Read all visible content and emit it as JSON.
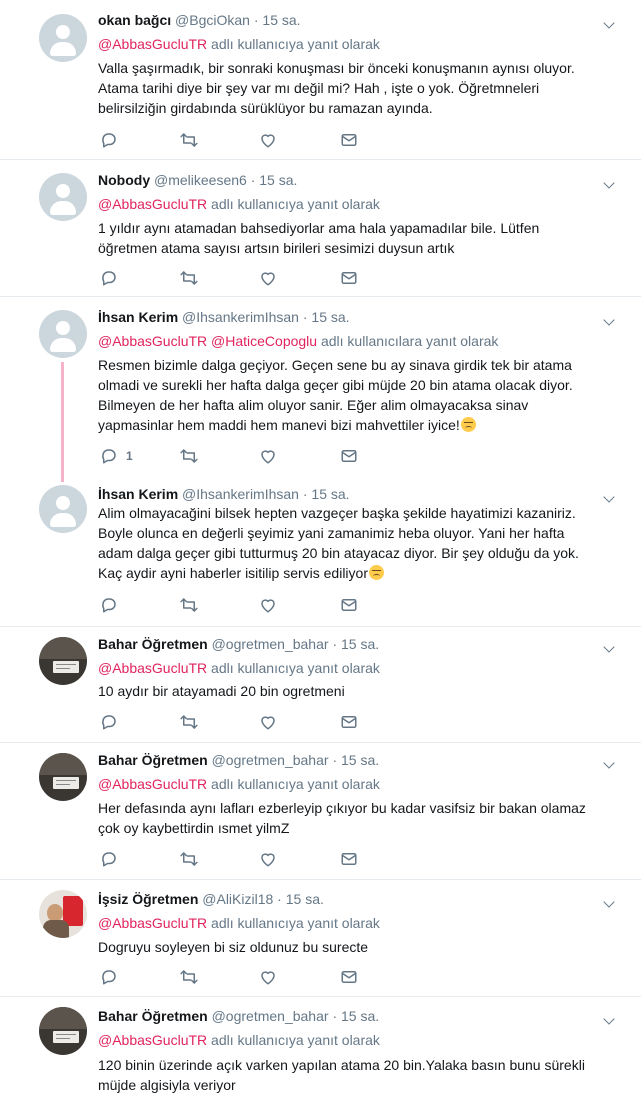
{
  "colors": {
    "mention": "#e0245e",
    "secondary_text": "#657786",
    "primary_text": "#14171a",
    "divider": "#e6ecf0",
    "thread_line": "#f4b3c6"
  },
  "icons": {
    "reply": "reply-icon",
    "retweet": "retweet-icon",
    "like": "heart-icon",
    "dm": "envelope-icon",
    "more": "chevron-down-icon"
  },
  "tweets": [
    {
      "avatar": "default-avatar",
      "name": "okan bağcı",
      "handle": "@BgciOkan",
      "dot": "·",
      "time": "15 sa.",
      "reply_mention": "@AbbasGucluTR",
      "reply_suffix": "adlı kullanıcıya yanıt olarak",
      "text": "Valla şaşırmadık, bir sonraki konuşması bir önceki konuşmanın aynısı oluyor.\nAtama tarihi diye bir şey var mı değil mi? Hah , işte o yok. Öğretmneleri\nbelirsilziğin girdabında sürüklüyor bu ramazan ayında.",
      "reply_count": ""
    },
    {
      "avatar": "default-avatar",
      "name": "Nobody",
      "handle": "@melikeesen6",
      "dot": "·",
      "time": "15 sa.",
      "reply_mention": "@AbbasGucluTR",
      "reply_suffix": "adlı kullanıcıya yanıt olarak",
      "text": "1 yıldır aynı atamadan bahsediyorlar ama hala yapamadılar bile. Lütfen\nöğretmen atama sayısı artsın birileri sesimizi duysun artık",
      "reply_count": ""
    },
    {
      "avatar": "default-avatar",
      "name": "İhsan Kerim",
      "handle": "@IhsankerimIhsan",
      "dot": "·",
      "time": "15 sa.",
      "reply_mention": "@AbbasGucluTR @HaticeCopoglu",
      "reply_suffix": "adlı kullanıcılara yanıt olarak",
      "text": "Resmen bizimle dalga geçiyor. Geçen sene bu ay sinava girdik tek bir atama\nolmadi ve surekli her hafta dalga geçer gibi müjde 20 bin atama olacak diyor.\nBilmeyen de her hafta alim oluyor sanir. Eğer alim olmayacaksa sinav\nyapmasinlar hem maddi hem manevi bizi mahvettiler iyice!",
      "reply_count": "1"
    },
    {
      "avatar": "default-avatar",
      "name": "İhsan Kerim",
      "handle": "@IhsankerimIhsan",
      "dot": "·",
      "time": "15 sa.",
      "reply_mention": "",
      "reply_suffix": "",
      "text": "Alim olmayacağini bilsek hepten vazgeçer başka şekilde hayatimizi kazaniriz.\nBoyle olunca en değerli şeyimiz yani zamanimiz heba oluyor. Yani her hafta\nadam dalga geçer gibi tutturmuş 20 bin atayacaz diyor. Bir şey olduğu da yok.\nKaç aydir ayni haberler isitilip servis ediliyor",
      "reply_count": ""
    },
    {
      "avatar": "photo-dark",
      "name": "Bahar Öğretmen",
      "handle": "@ogretmen_bahar",
      "dot": "·",
      "time": "15 sa.",
      "reply_mention": "@AbbasGucluTR",
      "reply_suffix": "adlı kullanıcıya yanıt olarak",
      "text": "10 aydır bir atayamadi 20 bin ogretmeni",
      "reply_count": ""
    },
    {
      "avatar": "photo-dark",
      "name": "Bahar Öğretmen",
      "handle": "@ogretmen_bahar",
      "dot": "·",
      "time": "15 sa.",
      "reply_mention": "@AbbasGucluTR",
      "reply_suffix": "adlı kullanıcıya yanıt olarak",
      "text": "Her defasında aynı lafları ezberleyip çıkıyor bu kadar vasifsiz bir bakan olamaz\nçok oy kaybettirdin ısmet yilmZ",
      "reply_count": ""
    },
    {
      "avatar": "photo-flag",
      "name": "İşsiz Öğretmen",
      "handle": "@AliKizil18",
      "dot": "·",
      "time": "15 sa.",
      "reply_mention": "@AbbasGucluTR",
      "reply_suffix": "adlı kullanıcıya yanıt olarak",
      "text": "Dogruyu soyleyen bi siz oldunuz bu surecte",
      "reply_count": ""
    },
    {
      "avatar": "photo-dark",
      "name": "Bahar Öğretmen",
      "handle": "@ogretmen_bahar",
      "dot": "·",
      "time": "15 sa.",
      "reply_mention": "@AbbasGucluTR",
      "reply_suffix": "adlı kullanıcıya yanıt olarak",
      "text": "120 binin üzerinde açık varken yapılan atama 20 bin.Yalaka basın bunu sürekli\nmüjde algisiyla veriyor",
      "reply_count": ""
    }
  ]
}
